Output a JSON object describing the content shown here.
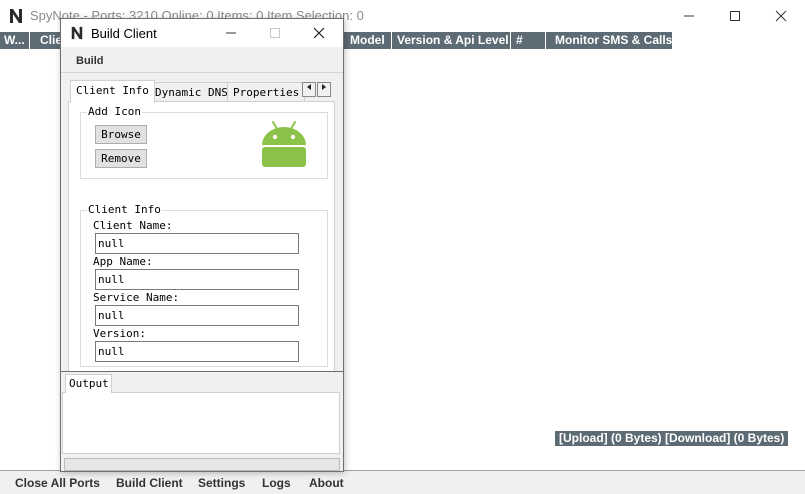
{
  "main": {
    "title": "SpyNote - Ports: 3210 Online: 0 Items: 0 Item Selection: 0",
    "columns": [
      "W...",
      "Clie",
      "Model",
      "Version & Api Level",
      "#",
      "Monitor SMS & Calls"
    ],
    "status_text": "[Upload] (0 Bytes) [Download] (0 Bytes)",
    "bottom_menu": [
      "Close All Ports",
      "Build Client",
      "Settings",
      "Logs",
      "About"
    ]
  },
  "dialog": {
    "title": "Build Client",
    "menu_build": "Build",
    "tabs": [
      "Client Info",
      "Dynamic DNS",
      "Properties"
    ],
    "add_icon": {
      "legend": "Add Icon",
      "browse_label": "Browse",
      "remove_label": "Remove",
      "icon_name": "android-icon"
    },
    "client_info": {
      "legend": "Client Info",
      "fields": [
        {
          "label": "Client Name:",
          "value": "null"
        },
        {
          "label": "App Name:",
          "value": "null"
        },
        {
          "label": "Service Name:",
          "value": "null"
        },
        {
          "label": "Version:",
          "value": "null"
        }
      ]
    },
    "output_tab": "Output",
    "progress": 0
  },
  "colors": {
    "column_header_bg": "#5d6b75",
    "android_green": "#8bc34a"
  }
}
